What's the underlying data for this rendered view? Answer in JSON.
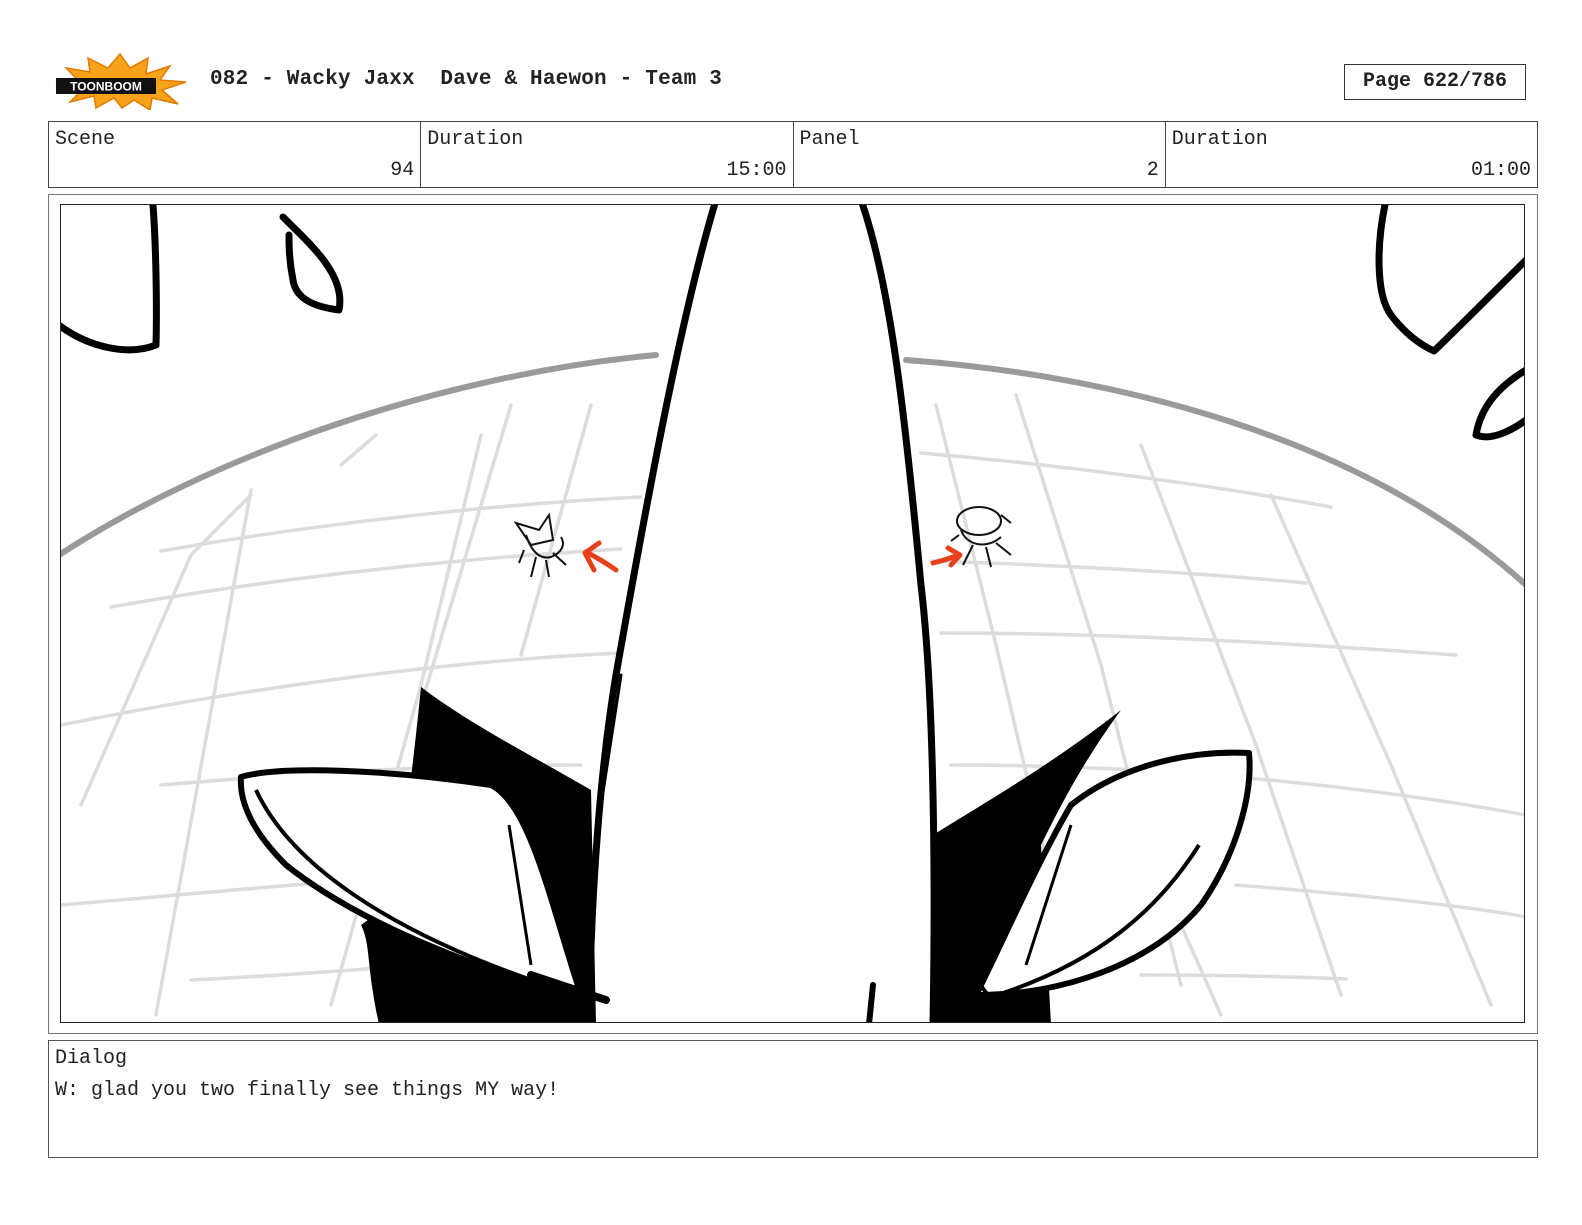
{
  "header": {
    "logo_text": "TOONBOOM",
    "title": "082 - Wacky Jaxx  Dave & Haewon - Team 3",
    "page": "Page 622/786"
  },
  "info": {
    "scene_label": "Scene",
    "scene_value": "94",
    "scene_duration_label": "Duration",
    "scene_duration_value": "15:00",
    "panel_label": "Panel",
    "panel_value": "2",
    "panel_duration_label": "Duration",
    "panel_duration_value": "01:00"
  },
  "dialog": {
    "label": "Dialog",
    "text": "W: glad you two finally see things MY way!"
  },
  "colors": {
    "arrow": "#e8401c",
    "logo_burst": "#f7a21b",
    "ink": "#000000",
    "grid": "#d9d9d9",
    "horizon": "#9a9a9a"
  }
}
